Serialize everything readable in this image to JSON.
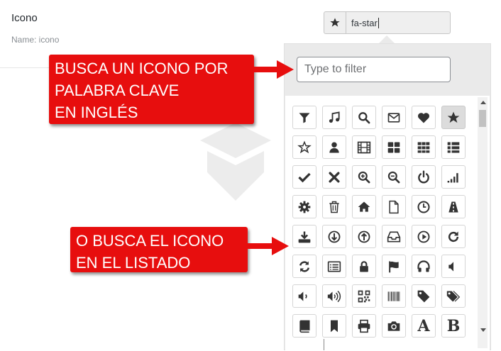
{
  "field": {
    "label": "Icono",
    "name_hint": "Name: icono"
  },
  "picker": {
    "current_icon": "star-icon",
    "value": "fa-star"
  },
  "filter": {
    "placeholder": "Type to filter",
    "value": ""
  },
  "callouts": {
    "keyword": [
      "BUSCA UN ICONO POR",
      "PALABRA CLAVE",
      "EN INGLÉS"
    ],
    "list": [
      "O BUSCA EL ICONO",
      "EN EL LISTADO"
    ],
    "color": "#e70e0e"
  },
  "icons": [
    "filter-icon",
    "music-icon",
    "search-icon",
    "envelope-icon",
    "heart-icon",
    "star-icon",
    "star-outline-icon",
    "user-icon",
    "film-icon",
    "th-large-icon",
    "th-icon",
    "th-list-icon",
    "check-icon",
    "times-icon",
    "search-plus-icon",
    "search-minus-icon",
    "power-off-icon",
    "signal-icon",
    "cog-icon",
    "trash-icon",
    "home-icon",
    "file-icon",
    "clock-icon",
    "road-icon",
    "download-icon",
    "arrow-circle-down-icon",
    "arrow-circle-up-icon",
    "inbox-icon",
    "play-circle-icon",
    "repeat-icon",
    "refresh-icon",
    "list-alt-icon",
    "lock-icon",
    "flag-icon",
    "headphones-icon",
    "volume-off-icon",
    "volume-down-icon",
    "volume-up-icon",
    "qrcode-icon",
    "barcode-icon",
    "tag-icon",
    "tags-icon",
    "book-icon",
    "bookmark-icon",
    "print-icon",
    "camera-icon",
    "font-icon",
    "bold-icon"
  ],
  "selected_icon": "star-icon",
  "font_glyphs": {
    "font-icon": "A",
    "bold-icon": "B"
  }
}
